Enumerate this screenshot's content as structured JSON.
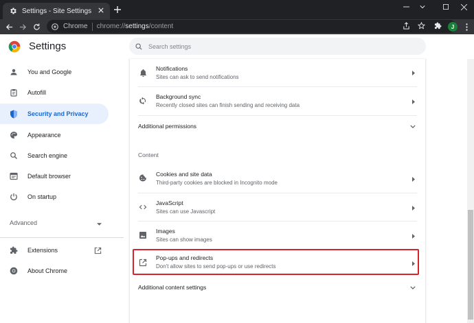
{
  "tab": {
    "title": "Settings - Site Settings"
  },
  "address_bar": {
    "site_label": "Chrome",
    "url_prefix": "chrome://",
    "url_host": "settings",
    "url_path": "/content"
  },
  "profile": {
    "initial": "J"
  },
  "header": {
    "title": "Settings",
    "search_placeholder": "Search settings"
  },
  "sidebar": {
    "items": [
      {
        "label": "You and Google",
        "icon": "person-icon"
      },
      {
        "label": "Autofill",
        "icon": "clipboard-icon"
      },
      {
        "label": "Security and Privacy",
        "icon": "shield-icon",
        "active": true
      },
      {
        "label": "Appearance",
        "icon": "palette-icon"
      },
      {
        "label": "Search engine",
        "icon": "search-icon"
      },
      {
        "label": "Default browser",
        "icon": "browser-icon"
      },
      {
        "label": "On startup",
        "icon": "power-icon"
      }
    ],
    "advanced_label": "Advanced",
    "extensions_label": "Extensions",
    "about_label": "About Chrome"
  },
  "content": {
    "notifications": {
      "title": "Notifications",
      "subtitle": "Sites can ask to send notifications"
    },
    "background_sync": {
      "title": "Background sync",
      "subtitle": "Recently closed sites can finish sending and receiving data"
    },
    "additional_permissions": "Additional permissions",
    "section_label": "Content",
    "cookies": {
      "title": "Cookies and site data",
      "subtitle": "Third-party cookies are blocked in Incognito mode"
    },
    "javascript": {
      "title": "JavaScript",
      "subtitle": "Sites can use Javascript"
    },
    "images": {
      "title": "Images",
      "subtitle": "Sites can show images"
    },
    "popups": {
      "title": "Pop-ups and redirects",
      "subtitle": "Don't allow sites to send pop-ups or use redirects"
    },
    "additional_content": "Additional content settings"
  },
  "colors": {
    "accent": "#1967d2",
    "active_bg": "#e8f0fe",
    "highlight_border": "#d6222c",
    "titlebar": "#202124",
    "toolbar": "#35363a"
  }
}
